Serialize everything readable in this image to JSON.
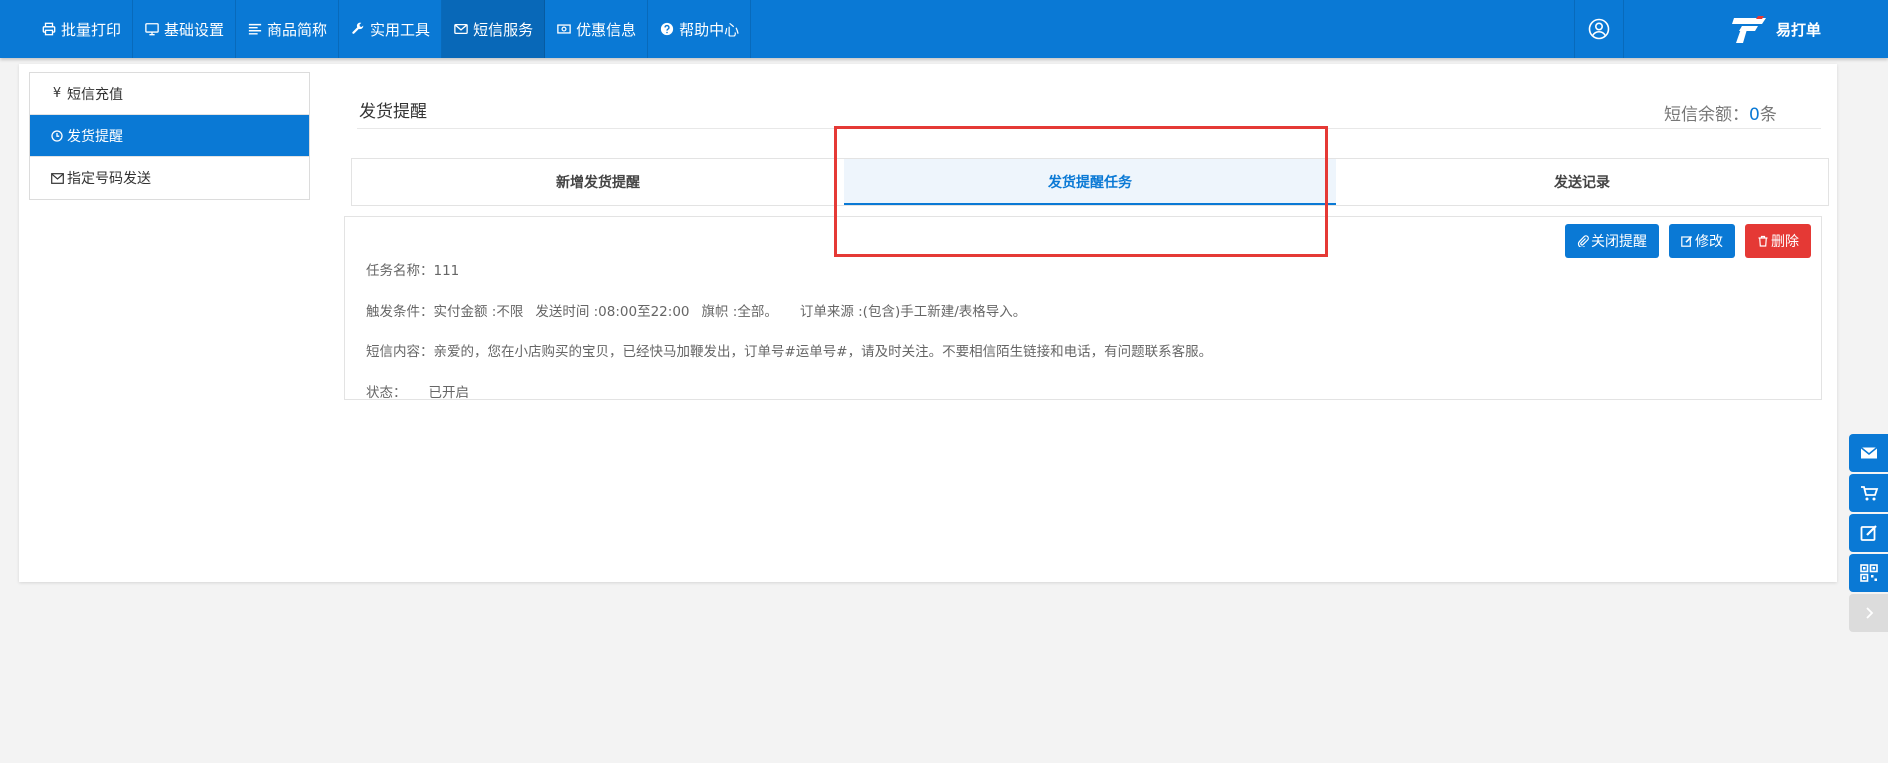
{
  "nav": {
    "items": [
      {
        "label": "批量打印",
        "icon": "printer-icon"
      },
      {
        "label": "基础设置",
        "icon": "monitor-icon"
      },
      {
        "label": "商品简称",
        "icon": "list-icon"
      },
      {
        "label": "实用工具",
        "icon": "wrench-icon"
      },
      {
        "label": "短信服务",
        "icon": "envelope-icon"
      },
      {
        "label": "优惠信息",
        "icon": "money-icon"
      },
      {
        "label": "帮助中心",
        "icon": "question-icon"
      }
    ],
    "active_index": 4
  },
  "brand": {
    "name": "易打单"
  },
  "sidebar": {
    "items": [
      {
        "label": "短信充值",
        "icon": "yen-icon"
      },
      {
        "label": "发货提醒",
        "icon": "clock-icon"
      },
      {
        "label": "指定号码发送",
        "icon": "envelope-icon"
      }
    ],
    "active_index": 1
  },
  "content": {
    "title": "发货提醒",
    "balance_label": "短信余额：",
    "balance_value": "0",
    "balance_unit": "条"
  },
  "tabs": [
    {
      "label": "新增发货提醒"
    },
    {
      "label": "发货提醒任务"
    },
    {
      "label": "发送记录"
    }
  ],
  "task": {
    "buttons": {
      "close": "关闭提醒",
      "edit": "修改",
      "delete": "删除"
    },
    "name_label": "任务名称：",
    "name_value": "111",
    "trigger_label": "触发条件：",
    "amount": "实付金额 :不限",
    "time": "发送时间 :08:00至22:00",
    "flag": "旗帜 :全部。",
    "source": "订单来源 :(包含)手工新建/表格导入。",
    "sms_label": "短信内容：",
    "sms_value": "亲爱的，您在小店购买的宝贝，已经快马加鞭发出，订单号#运单号#，请及时关注。不要相信陌生链接和电话，有问题联系客服。",
    "status_label": "状态：",
    "status_value": "已开启"
  },
  "colors": {
    "primary": "#0a79d5",
    "danger": "#e53935",
    "highlight": "#e53935"
  }
}
